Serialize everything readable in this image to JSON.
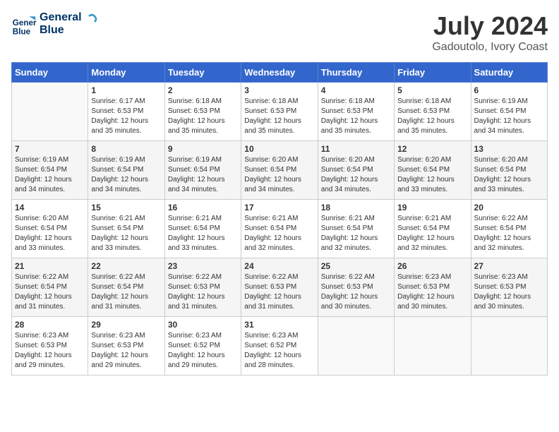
{
  "header": {
    "logo_line1": "General",
    "logo_line2": "Blue",
    "month": "July 2024",
    "location": "Gadoutolo, Ivory Coast"
  },
  "weekdays": [
    "Sunday",
    "Monday",
    "Tuesday",
    "Wednesday",
    "Thursday",
    "Friday",
    "Saturday"
  ],
  "weeks": [
    [
      {
        "day": "",
        "info": ""
      },
      {
        "day": "1",
        "info": "Sunrise: 6:17 AM\nSunset: 6:53 PM\nDaylight: 12 hours\nand 35 minutes."
      },
      {
        "day": "2",
        "info": "Sunrise: 6:18 AM\nSunset: 6:53 PM\nDaylight: 12 hours\nand 35 minutes."
      },
      {
        "day": "3",
        "info": "Sunrise: 6:18 AM\nSunset: 6:53 PM\nDaylight: 12 hours\nand 35 minutes."
      },
      {
        "day": "4",
        "info": "Sunrise: 6:18 AM\nSunset: 6:53 PM\nDaylight: 12 hours\nand 35 minutes."
      },
      {
        "day": "5",
        "info": "Sunrise: 6:18 AM\nSunset: 6:53 PM\nDaylight: 12 hours\nand 35 minutes."
      },
      {
        "day": "6",
        "info": "Sunrise: 6:19 AM\nSunset: 6:54 PM\nDaylight: 12 hours\nand 34 minutes."
      }
    ],
    [
      {
        "day": "7",
        "info": "Sunrise: 6:19 AM\nSunset: 6:54 PM\nDaylight: 12 hours\nand 34 minutes."
      },
      {
        "day": "8",
        "info": "Sunrise: 6:19 AM\nSunset: 6:54 PM\nDaylight: 12 hours\nand 34 minutes."
      },
      {
        "day": "9",
        "info": "Sunrise: 6:19 AM\nSunset: 6:54 PM\nDaylight: 12 hours\nand 34 minutes."
      },
      {
        "day": "10",
        "info": "Sunrise: 6:20 AM\nSunset: 6:54 PM\nDaylight: 12 hours\nand 34 minutes."
      },
      {
        "day": "11",
        "info": "Sunrise: 6:20 AM\nSunset: 6:54 PM\nDaylight: 12 hours\nand 34 minutes."
      },
      {
        "day": "12",
        "info": "Sunrise: 6:20 AM\nSunset: 6:54 PM\nDaylight: 12 hours\nand 33 minutes."
      },
      {
        "day": "13",
        "info": "Sunrise: 6:20 AM\nSunset: 6:54 PM\nDaylight: 12 hours\nand 33 minutes."
      }
    ],
    [
      {
        "day": "14",
        "info": "Sunrise: 6:20 AM\nSunset: 6:54 PM\nDaylight: 12 hours\nand 33 minutes."
      },
      {
        "day": "15",
        "info": "Sunrise: 6:21 AM\nSunset: 6:54 PM\nDaylight: 12 hours\nand 33 minutes."
      },
      {
        "day": "16",
        "info": "Sunrise: 6:21 AM\nSunset: 6:54 PM\nDaylight: 12 hours\nand 33 minutes."
      },
      {
        "day": "17",
        "info": "Sunrise: 6:21 AM\nSunset: 6:54 PM\nDaylight: 12 hours\nand 32 minutes."
      },
      {
        "day": "18",
        "info": "Sunrise: 6:21 AM\nSunset: 6:54 PM\nDaylight: 12 hours\nand 32 minutes."
      },
      {
        "day": "19",
        "info": "Sunrise: 6:21 AM\nSunset: 6:54 PM\nDaylight: 12 hours\nand 32 minutes."
      },
      {
        "day": "20",
        "info": "Sunrise: 6:22 AM\nSunset: 6:54 PM\nDaylight: 12 hours\nand 32 minutes."
      }
    ],
    [
      {
        "day": "21",
        "info": "Sunrise: 6:22 AM\nSunset: 6:54 PM\nDaylight: 12 hours\nand 31 minutes."
      },
      {
        "day": "22",
        "info": "Sunrise: 6:22 AM\nSunset: 6:54 PM\nDaylight: 12 hours\nand 31 minutes."
      },
      {
        "day": "23",
        "info": "Sunrise: 6:22 AM\nSunset: 6:53 PM\nDaylight: 12 hours\nand 31 minutes."
      },
      {
        "day": "24",
        "info": "Sunrise: 6:22 AM\nSunset: 6:53 PM\nDaylight: 12 hours\nand 31 minutes."
      },
      {
        "day": "25",
        "info": "Sunrise: 6:22 AM\nSunset: 6:53 PM\nDaylight: 12 hours\nand 30 minutes."
      },
      {
        "day": "26",
        "info": "Sunrise: 6:23 AM\nSunset: 6:53 PM\nDaylight: 12 hours\nand 30 minutes."
      },
      {
        "day": "27",
        "info": "Sunrise: 6:23 AM\nSunset: 6:53 PM\nDaylight: 12 hours\nand 30 minutes."
      }
    ],
    [
      {
        "day": "28",
        "info": "Sunrise: 6:23 AM\nSunset: 6:53 PM\nDaylight: 12 hours\nand 29 minutes."
      },
      {
        "day": "29",
        "info": "Sunrise: 6:23 AM\nSunset: 6:53 PM\nDaylight: 12 hours\nand 29 minutes."
      },
      {
        "day": "30",
        "info": "Sunrise: 6:23 AM\nSunset: 6:52 PM\nDaylight: 12 hours\nand 29 minutes."
      },
      {
        "day": "31",
        "info": "Sunrise: 6:23 AM\nSunset: 6:52 PM\nDaylight: 12 hours\nand 28 minutes."
      },
      {
        "day": "",
        "info": ""
      },
      {
        "day": "",
        "info": ""
      },
      {
        "day": "",
        "info": ""
      }
    ]
  ]
}
